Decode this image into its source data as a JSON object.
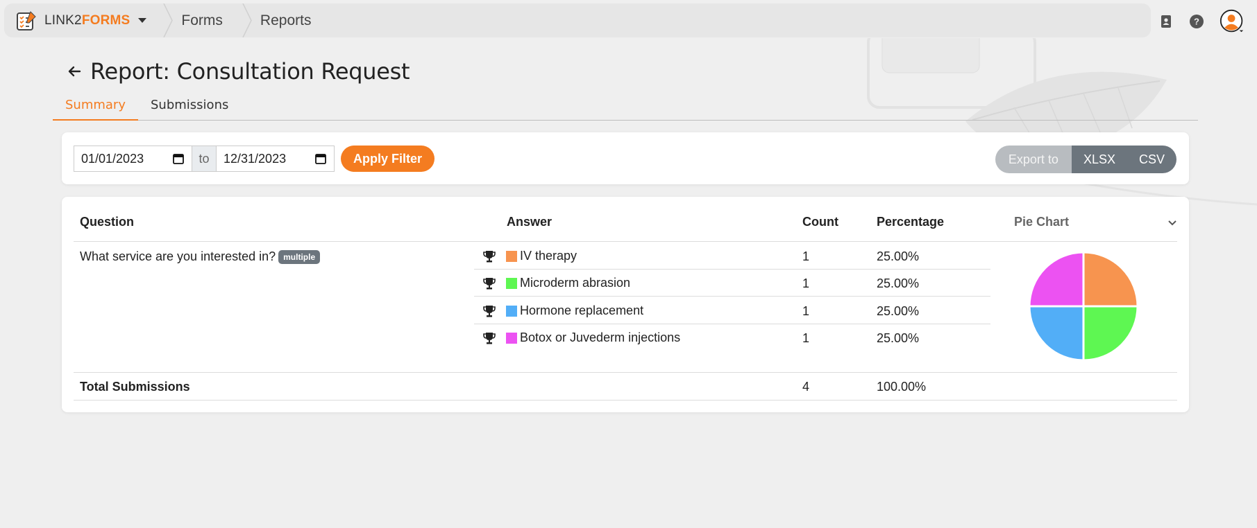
{
  "brand": {
    "prefix": "LINK2",
    "suffix": "FORMS"
  },
  "breadcrumbs": [
    "Forms",
    "Reports"
  ],
  "page": {
    "title": "Report: Consultation Request"
  },
  "tabs": [
    {
      "label": "Summary",
      "active": true
    },
    {
      "label": "Submissions",
      "active": false
    }
  ],
  "filter": {
    "from": "01/01/2023",
    "separator": "to",
    "to": "12/31/2023",
    "apply_label": "Apply Filter"
  },
  "export": {
    "label": "Export to",
    "xlsx": "XLSX",
    "csv": "CSV"
  },
  "table": {
    "headers": {
      "question": "Question",
      "answer": "Answer",
      "count": "Count",
      "percentage": "Percentage",
      "chart": "Pie Chart"
    },
    "question": "What service are you interested in?",
    "badge": "multiple",
    "answers": [
      {
        "label": "IV therapy",
        "count": "1",
        "percentage": "25.00%",
        "color": "#f7944f"
      },
      {
        "label": "Microderm abrasion",
        "count": "1",
        "percentage": "25.00%",
        "color": "#5ef752"
      },
      {
        "label": "Hormone replacement",
        "count": "1",
        "percentage": "25.00%",
        "color": "#52aef7"
      },
      {
        "label": "Botox or Juvederm injections",
        "count": "1",
        "percentage": "25.00%",
        "color": "#ec52f2"
      }
    ],
    "total": {
      "label": "Total Submissions",
      "count": "4",
      "percentage": "100.00%"
    }
  },
  "colors": {
    "accent": "#f47c20",
    "export_bg": "#6c757d"
  },
  "icons": [
    "address-book-icon",
    "help-icon",
    "user-avatar-icon",
    "back-arrow-icon",
    "calendar-icon",
    "trophy-icon",
    "chevron-down-icon"
  ]
}
